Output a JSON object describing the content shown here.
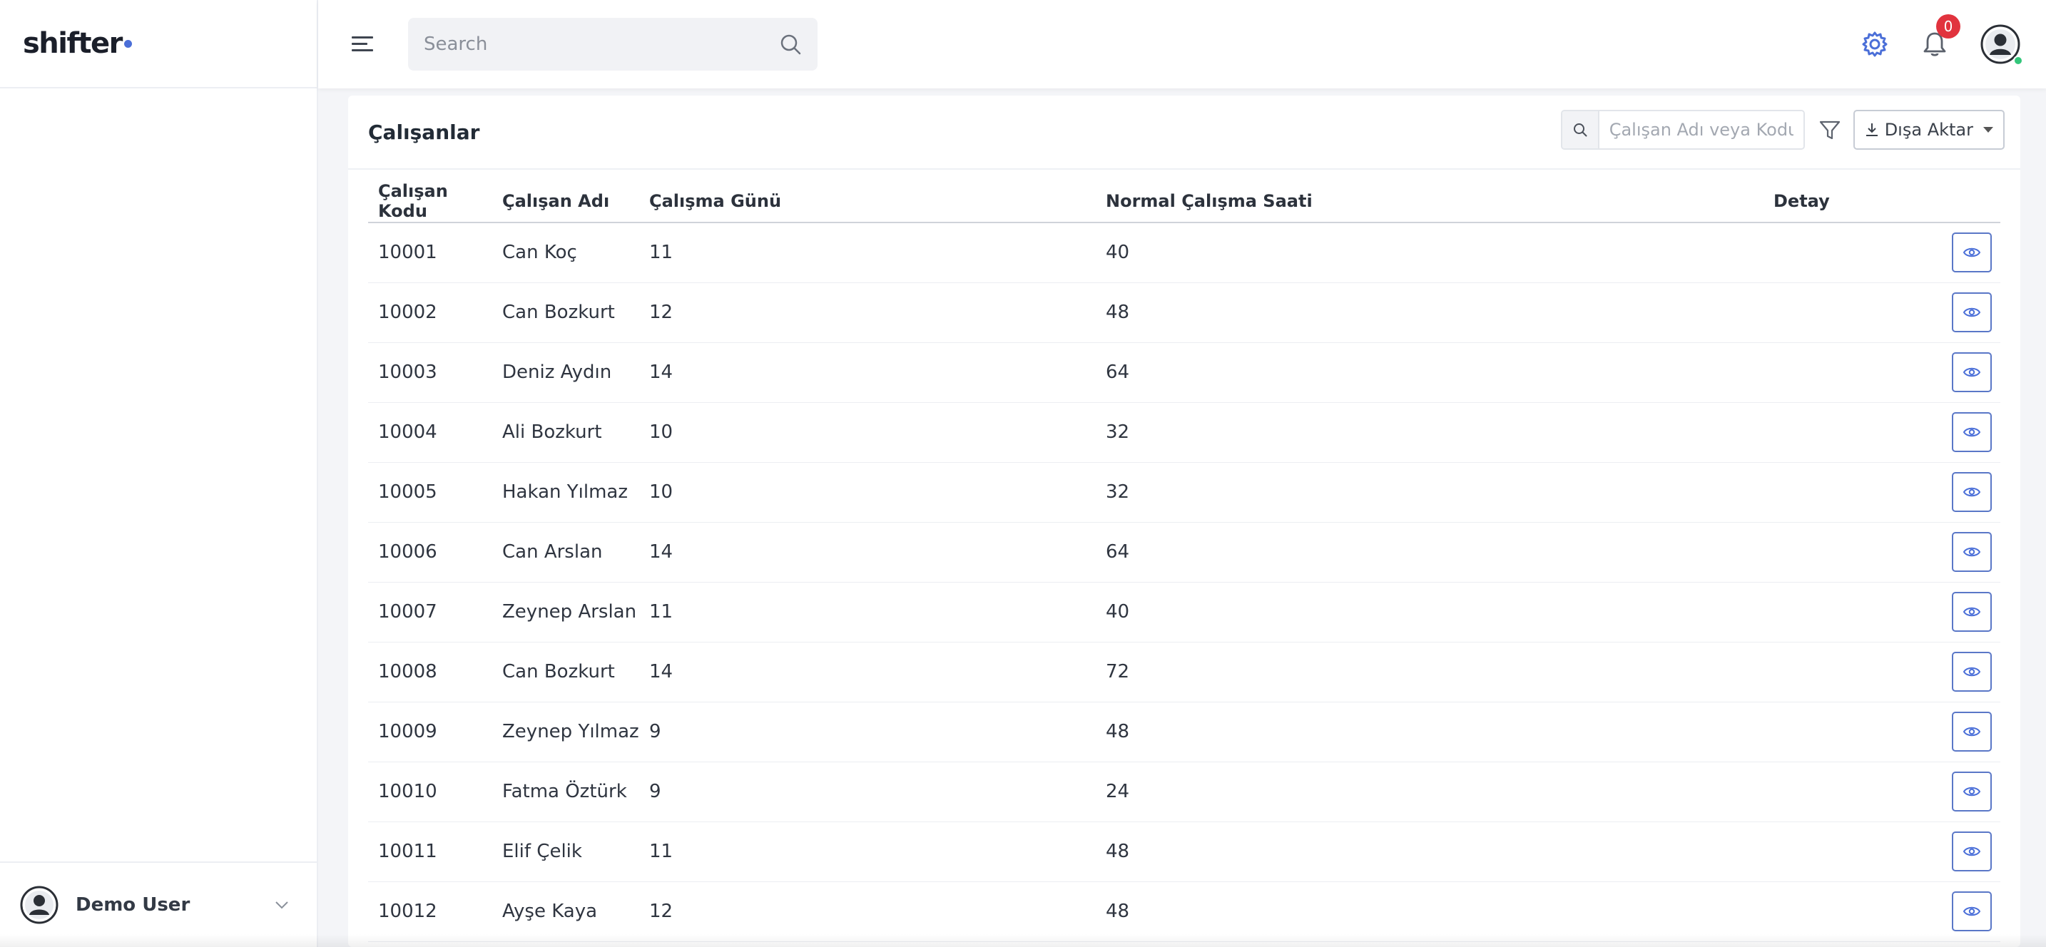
{
  "brand": {
    "name": "shifter"
  },
  "sidebar": {
    "user": {
      "name": "Demo User"
    }
  },
  "topbar": {
    "search_placeholder": "Search",
    "notifications_count": "0"
  },
  "page": {
    "title": "Çalışanlar",
    "filter_placeholder": "Çalışan Adı veya Kodu",
    "export_label": "Dışa Aktar"
  },
  "table": {
    "columns": [
      "Çalışan Kodu",
      "Çalışan Adı",
      "Çalışma Günü",
      "Normal Çalışma Saati",
      "Detay"
    ],
    "rows": [
      {
        "code": "10001",
        "name": "Can Koç",
        "days": "11",
        "hours": "40"
      },
      {
        "code": "10002",
        "name": "Can Bozkurt",
        "days": "12",
        "hours": "48"
      },
      {
        "code": "10003",
        "name": "Deniz Aydın",
        "days": "14",
        "hours": "64"
      },
      {
        "code": "10004",
        "name": "Ali Bozkurt",
        "days": "10",
        "hours": "32"
      },
      {
        "code": "10005",
        "name": "Hakan Yılmaz",
        "days": "10",
        "hours": "32"
      },
      {
        "code": "10006",
        "name": "Can Arslan",
        "days": "14",
        "hours": "64"
      },
      {
        "code": "10007",
        "name": "Zeynep Arslan",
        "days": "11",
        "hours": "40"
      },
      {
        "code": "10008",
        "name": "Can Bozkurt",
        "days": "14",
        "hours": "72"
      },
      {
        "code": "10009",
        "name": "Zeynep Yılmaz",
        "days": "9",
        "hours": "48"
      },
      {
        "code": "10010",
        "name": "Fatma Öztürk",
        "days": "9",
        "hours": "24"
      },
      {
        "code": "10011",
        "name": "Elif Çelik",
        "days": "11",
        "hours": "48"
      },
      {
        "code": "10012",
        "name": "Ayşe Kaya",
        "days": "12",
        "hours": "48"
      }
    ]
  },
  "colors": {
    "accent": "#4b6fd8",
    "badge": "#e1333e",
    "online": "#33c67a"
  },
  "icons": {
    "menu": "hamburger-icon",
    "search": "search-icon",
    "settings": "gear-icon",
    "notifications": "bell-icon",
    "avatar": "user-avatar-icon",
    "filter": "funnel-icon",
    "export": "download-icon",
    "detail": "eye-icon",
    "expand": "chevron-down-icon"
  }
}
